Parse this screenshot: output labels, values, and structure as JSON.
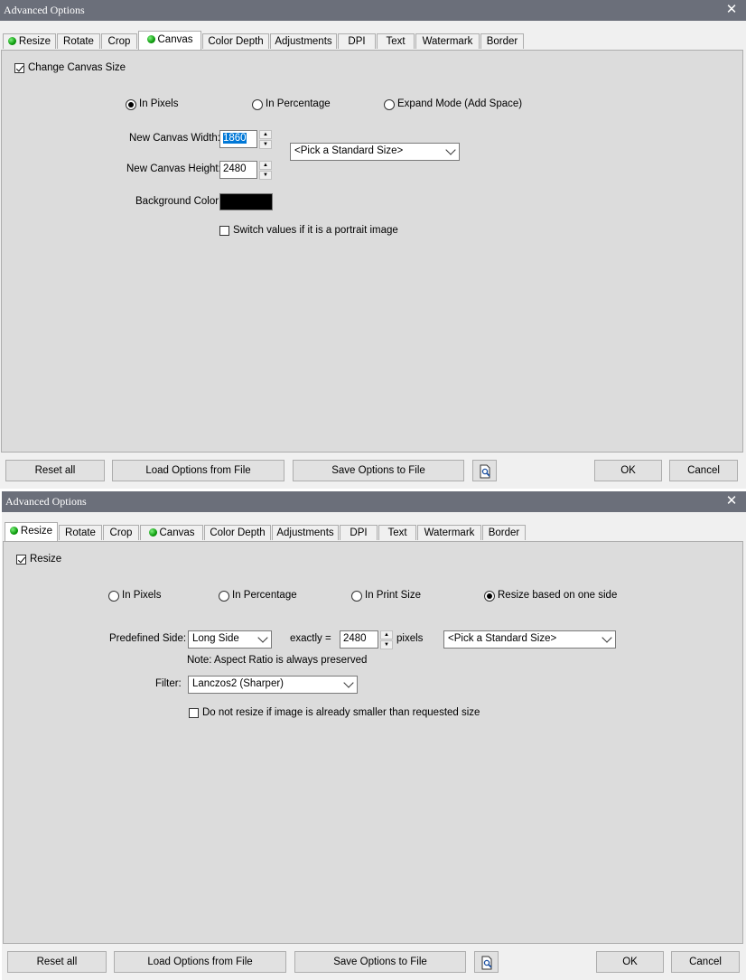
{
  "window1": {
    "title": "Advanced Options",
    "tabs": [
      {
        "label": "Resize",
        "dot": true
      },
      {
        "label": "Rotate",
        "dot": false
      },
      {
        "label": "Crop",
        "dot": false
      },
      {
        "label": "Canvas",
        "dot": true,
        "active": true
      },
      {
        "label": "Color Depth",
        "dot": false
      },
      {
        "label": "Adjustments",
        "dot": false
      },
      {
        "label": "DPI",
        "dot": false
      },
      {
        "label": "Text",
        "dot": false
      },
      {
        "label": "Watermark",
        "dot": false
      },
      {
        "label": "Border",
        "dot": false
      }
    ],
    "change_canvas_label": "Change Canvas Size",
    "change_canvas_checked": true,
    "mode_options": [
      "In Pixels",
      "In Percentage",
      "Expand Mode (Add Space)"
    ],
    "mode_selected": "In Pixels",
    "width_label": "New Canvas Width:",
    "width_value": "1860",
    "height_label": "New Canvas Height:",
    "height_value": "2480",
    "standard_size": "<Pick a Standard Size>",
    "bg_label": "Background Color:",
    "bg_color": "#000000",
    "switch_label": "Switch values if it is a portrait image",
    "switch_checked": false
  },
  "window2": {
    "title": "Advanced Options",
    "tabs": [
      {
        "label": "Resize",
        "dot": true,
        "active": true
      },
      {
        "label": "Rotate",
        "dot": false
      },
      {
        "label": "Crop",
        "dot": false
      },
      {
        "label": "Canvas",
        "dot": true
      },
      {
        "label": "Color Depth",
        "dot": false
      },
      {
        "label": "Adjustments",
        "dot": false
      },
      {
        "label": "DPI",
        "dot": false
      },
      {
        "label": "Text",
        "dot": false
      },
      {
        "label": "Watermark",
        "dot": false
      },
      {
        "label": "Border",
        "dot": false
      }
    ],
    "resize_label": "Resize",
    "resize_checked": true,
    "mode_options": [
      "In Pixels",
      "In Percentage",
      "In Print Size",
      "Resize based on one side"
    ],
    "mode_selected": "Resize based on one side",
    "side_label": "Predefined Side:",
    "side_value": "Long Side",
    "exactly_label": "exactly =",
    "exactly_value": "2480",
    "pixels_label": "pixels",
    "standard_size": "<Pick a Standard Size>",
    "note": "Note: Aspect Ratio is always preserved",
    "filter_label": "Filter:",
    "filter_value": "Lanczos2 (Sharper)",
    "no_resize_label": "Do not resize if image is already smaller than requested size",
    "no_resize_checked": false
  },
  "buttons": {
    "reset": "Reset all",
    "load": "Load Options from File",
    "save": "Save Options to File",
    "ok": "OK",
    "cancel": "Cancel"
  },
  "icons": {
    "close": "close-icon",
    "preview": "preview-file-icon",
    "indicator": "green-dot-icon"
  }
}
